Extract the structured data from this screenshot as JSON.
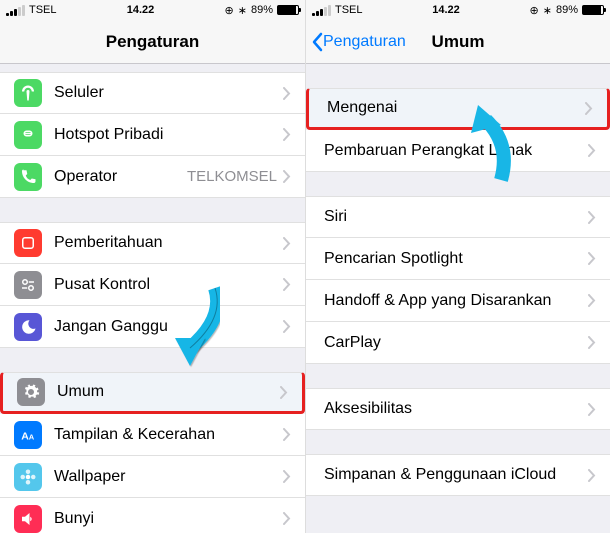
{
  "status": {
    "carrier": "TSEL",
    "time": "14.22",
    "battery_pct": "89%",
    "gps_icon": "⊕",
    "bt_icon": "∗"
  },
  "left": {
    "title": "Pengaturan",
    "groups": [
      [
        {
          "icon": "antenna",
          "bg": "#4cd964",
          "label": "Seluler"
        },
        {
          "icon": "link",
          "bg": "#4cd964",
          "label": "Hotspot Pribadi"
        },
        {
          "icon": "phone",
          "bg": "#4cd964",
          "label": "Operator",
          "detail": "TELKOMSEL"
        }
      ],
      [
        {
          "icon": "square",
          "bg": "#ff3b30",
          "label": "Pemberitahuan"
        },
        {
          "icon": "toggles",
          "bg": "#8e8e93",
          "label": "Pusat Kontrol"
        },
        {
          "icon": "moon",
          "bg": "#5856d6",
          "label": "Jangan Ganggu"
        }
      ],
      [
        {
          "icon": "gear",
          "bg": "#8e8e93",
          "label": "Umum",
          "highlight": true
        },
        {
          "icon": "textsize",
          "bg": "#007aff",
          "label": "Tampilan & Kecerahan"
        },
        {
          "icon": "flower",
          "bg": "#54c7ec",
          "label": "Wallpaper"
        },
        {
          "icon": "sound",
          "bg": "#ff2d55",
          "label": "Bunyi"
        }
      ]
    ]
  },
  "right": {
    "title": "Umum",
    "back_label": "Pengaturan",
    "groups": [
      [
        {
          "label": "Mengenai",
          "highlight": true
        },
        {
          "label": "Pembaruan Perangkat Lunak"
        }
      ],
      [
        {
          "label": "Siri"
        },
        {
          "label": "Pencarian Spotlight"
        },
        {
          "label": "Handoff & App yang Disarankan"
        },
        {
          "label": "CarPlay"
        }
      ],
      [
        {
          "label": "Aksesibilitas"
        }
      ],
      [
        {
          "label": "Simpanan & Penggunaan iCloud"
        }
      ]
    ]
  }
}
